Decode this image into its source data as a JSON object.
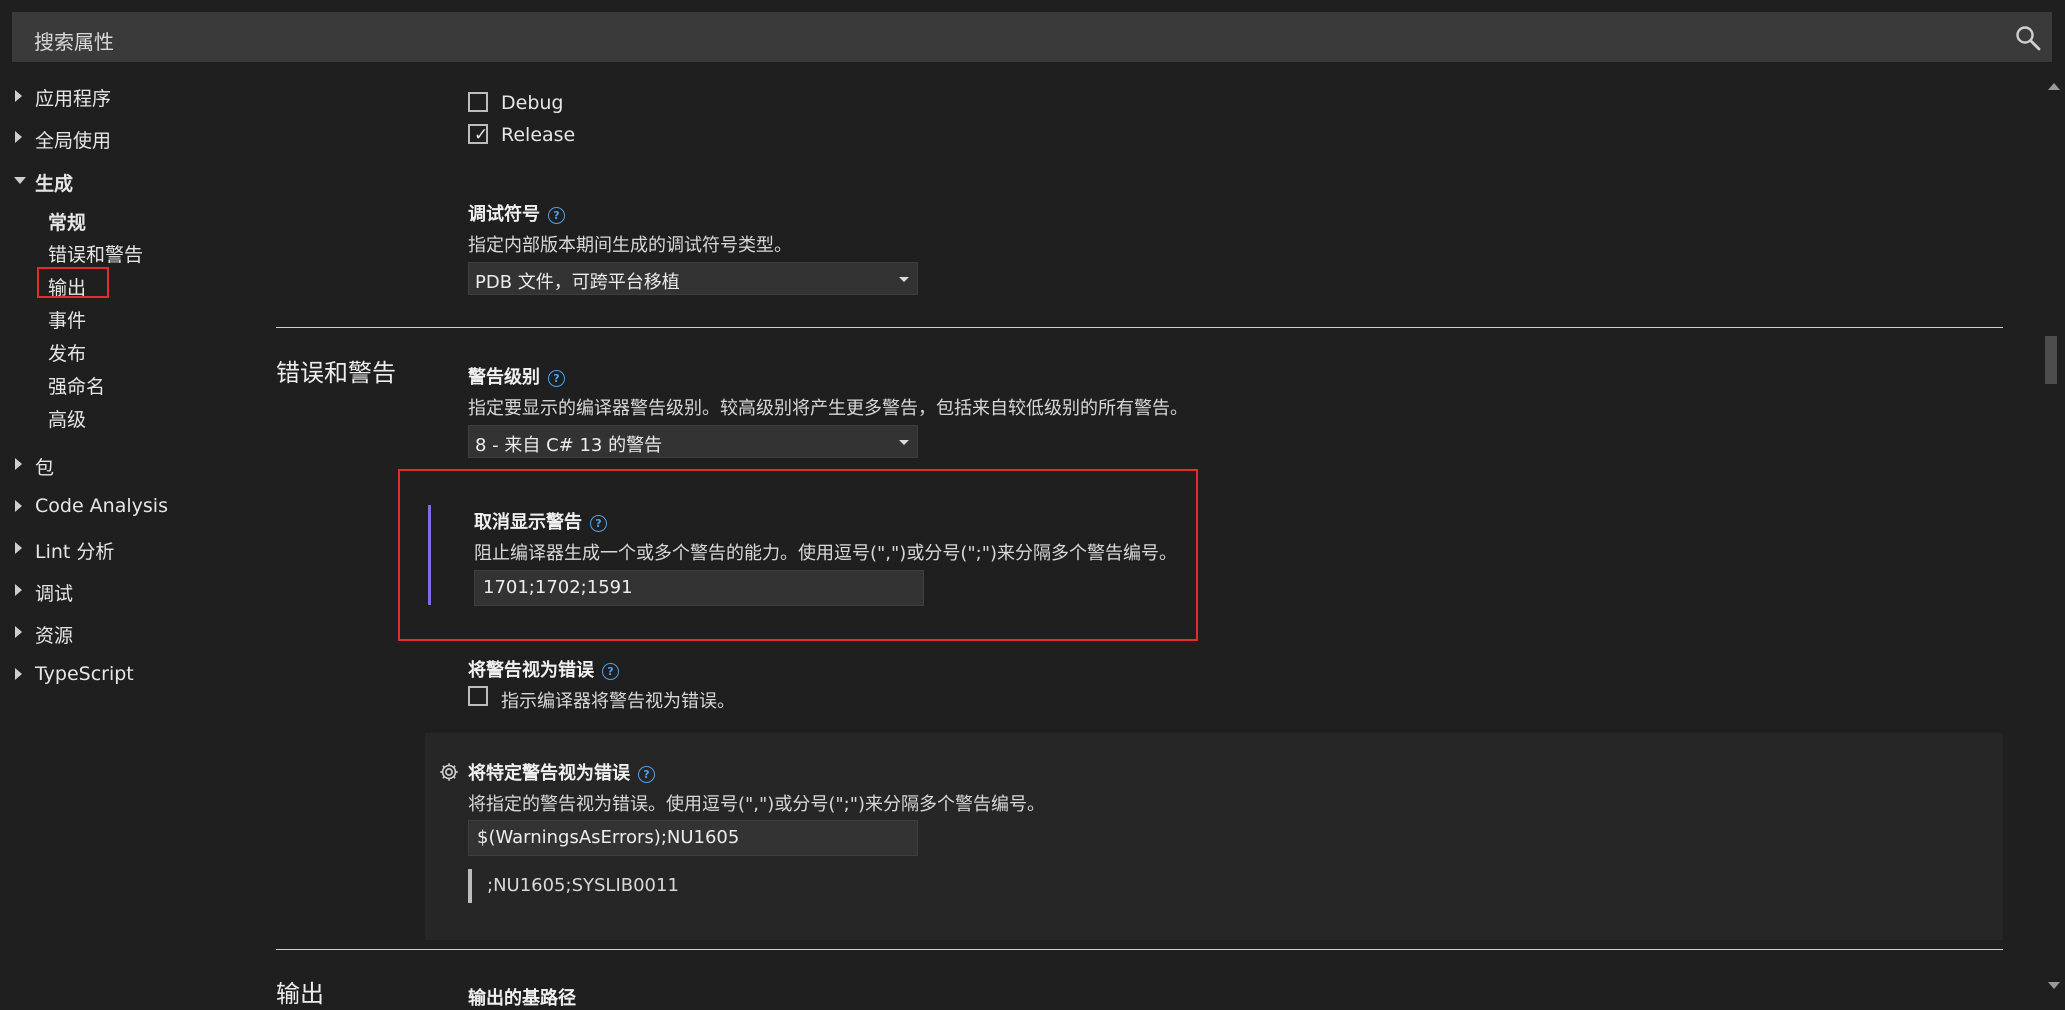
{
  "search": {
    "label": "搜索属性"
  },
  "sidebar": {
    "items": [
      {
        "label": "应用程序"
      },
      {
        "label": "全局使用"
      },
      {
        "label": "生成"
      },
      {
        "label": "包"
      },
      {
        "label": "Code Analysis"
      },
      {
        "label": "Lint 分析"
      },
      {
        "label": "调试"
      },
      {
        "label": "资源"
      },
      {
        "label": "TypeScript"
      }
    ],
    "build_children": [
      {
        "label": "常规"
      },
      {
        "label": "错误和警告"
      },
      {
        "label": "输出"
      },
      {
        "label": "事件"
      },
      {
        "label": "发布"
      },
      {
        "label": "强命名"
      },
      {
        "label": "高级"
      }
    ]
  },
  "content": {
    "config_checks": [
      {
        "label": "Debug",
        "checked": false
      },
      {
        "label": "Release",
        "checked": true
      }
    ],
    "debug_symbols": {
      "heading": "调试符号",
      "description": "指定内部版本期间生成的调试符号类型。",
      "value": "PDB 文件，可跨平台移植"
    },
    "errors_section_title": "错误和警告",
    "warning_level": {
      "heading": "警告级别",
      "description": "指定要显示的编译器警告级别。较高级别将产生更多警告，包括来自较低级别的所有警告。",
      "value": "8 - 来自 C# 13 的警告"
    },
    "suppress_warnings": {
      "heading": "取消显示警告",
      "description": "阻止编译器生成一个或多个警告的能力。使用逗号(\",\")或分号(\";\")来分隔多个警告编号。",
      "value": "1701;1702;1591"
    },
    "treat_warnings_as_errors": {
      "heading": "将警告视为错误",
      "checkbox_label": "指示编译器将警告视为错误。"
    },
    "specific_warnings_as_errors": {
      "heading": "将特定警告视为错误",
      "description": "将指定的警告视为错误。使用逗号(\",\")或分号(\";\")来分隔多个警告编号。",
      "value": "$(WarningsAsErrors);NU1605",
      "evaluated": ";NU1605;SYSLIB0011"
    },
    "output_section_title": "输出",
    "output_next_heading": "输出的基路径"
  },
  "help_glyph": "?",
  "colors": {
    "accent_purple": "#7d6de0",
    "highlight_red": "#e22d2d",
    "help_blue": "#4ea0e8"
  }
}
